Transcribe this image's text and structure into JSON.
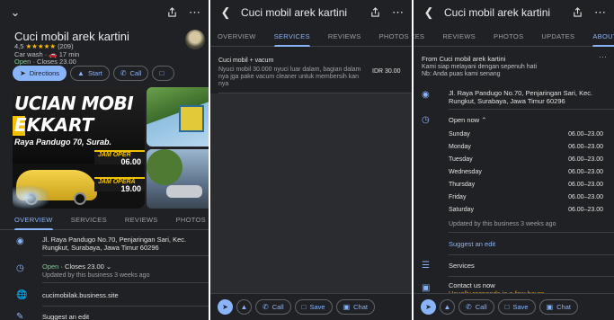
{
  "panel1": {
    "topbar": {
      "share_icon": "share-icon",
      "more": "⋯"
    },
    "title": "Cuci mobil arek kartini",
    "rating": "4,5",
    "stars": "★★★★★",
    "review_count": "(209)",
    "category_line": "Car wash · 🚗 17 min",
    "hours_open": "Open",
    "hours_close": " · Closes 23.00",
    "actions": {
      "directions": "Directions",
      "start": "Start",
      "call": "Call",
      "save_cut": ""
    },
    "photo": {
      "sign_line1": "UCIAN MOBI",
      "sign_line2": "EKKART",
      "address_sign": "Raya Pandugo 70, Surab.",
      "jam1_label": "JAM OPER",
      "jam1_value": "06.00",
      "jam2_label": "JAM OPERA",
      "jam2_value": "19.00"
    },
    "tabs": [
      "OVERVIEW",
      "SERVICES",
      "REVIEWS",
      "PHOTOS"
    ],
    "address": "Jl. Raya Pandugo No.70, Penjaringan Sari, Kec. Rungkut, Surabaya, Jawa Timur 60296",
    "open_status": "Open",
    "open_closes": " · Closes 23.00",
    "open_chevron": "⌄",
    "updated": "Updated by this business 3 weeks ago",
    "website": "cucimobilak.business.site",
    "suggest": "Suggest an edit"
  },
  "panel2": {
    "title": "Cuci mobil arek kartini",
    "tabs": [
      "OVERVIEW",
      "SERVICES",
      "REVIEWS",
      "PHOTOS"
    ],
    "service": {
      "name": "Cuci mobil + vacum",
      "description": "Nyuci mobil 30.000 nyuci luar dalam, bagian dalam nya jga pake vacum cleaner untuk membersih kan nya",
      "price": "IDR 30.00"
    },
    "bottom": {
      "call": "Call",
      "save": "Save",
      "chat": "Chat"
    }
  },
  "panel3": {
    "title": "Cuci mobil arek kartini",
    "tabs": [
      "CES",
      "REVIEWS",
      "PHOTOS",
      "UPDATES",
      "ABOUT"
    ],
    "from_title": "From Cuci mobil arek kartini",
    "from_line1": "Kami siap melayani dengan sepenuh hati",
    "from_line2": "Nb: Anda puas kami senang",
    "address": "Jl. Raya Pandugo No.70, Penjaringan Sari, Kec. Rungkut, Surabaya, Jawa Timur 60296",
    "open_now": "Open now",
    "schedule": [
      {
        "day": "Sunday",
        "hours": "06.00–23.00"
      },
      {
        "day": "Monday",
        "hours": "06.00–23.00"
      },
      {
        "day": "Tuesday",
        "hours": "06.00–23.00"
      },
      {
        "day": "Wednesday",
        "hours": "06.00–23.00"
      },
      {
        "day": "Thursday",
        "hours": "06.00–23.00"
      },
      {
        "day": "Friday",
        "hours": "06.00–23.00"
      },
      {
        "day": "Saturday",
        "hours": "06.00–23.00"
      }
    ],
    "updated": "Updated by this business 3 weeks ago",
    "suggest": "Suggest an edit",
    "services": "Services",
    "contact": "Contact us now",
    "responds": "Usually responds in a few hours",
    "bottom": {
      "call": "Call",
      "save": "Save",
      "chat": "Chat"
    }
  },
  "colors": {
    "background": "#202124",
    "accent": "#8ab4f8",
    "open": "#81c995",
    "star": "#fbbc04",
    "responds": "#f29900"
  }
}
